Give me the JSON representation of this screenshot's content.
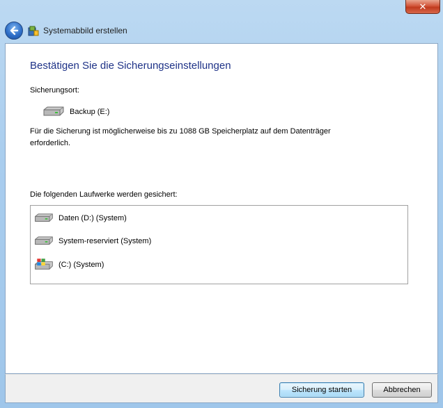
{
  "titlebar": {
    "close_label": "✕"
  },
  "nav": {
    "title": "Systemabbild erstellen"
  },
  "main": {
    "heading": "Bestätigen Sie die Sicherungseinstellungen",
    "location_label": "Sicherungsort:",
    "location_drive": "Backup (E:)",
    "space_note_line1": "Für die Sicherung ist möglicherweise bis zu 1088 GB Speicherplatz auf dem Datenträger",
    "space_note_line2": "erforderlich.",
    "drives_label": "Die folgenden Laufwerke werden gesichert:",
    "drives": [
      {
        "label": "Daten (D:) (System)",
        "icon": "hard-drive-icon"
      },
      {
        "label": "System-reserviert (System)",
        "icon": "hard-drive-icon"
      },
      {
        "label": "(C:) (System)",
        "icon": "windows-drive-icon"
      }
    ]
  },
  "footer": {
    "start_label": "Sicherung starten",
    "cancel_label": "Abbrechen"
  }
}
